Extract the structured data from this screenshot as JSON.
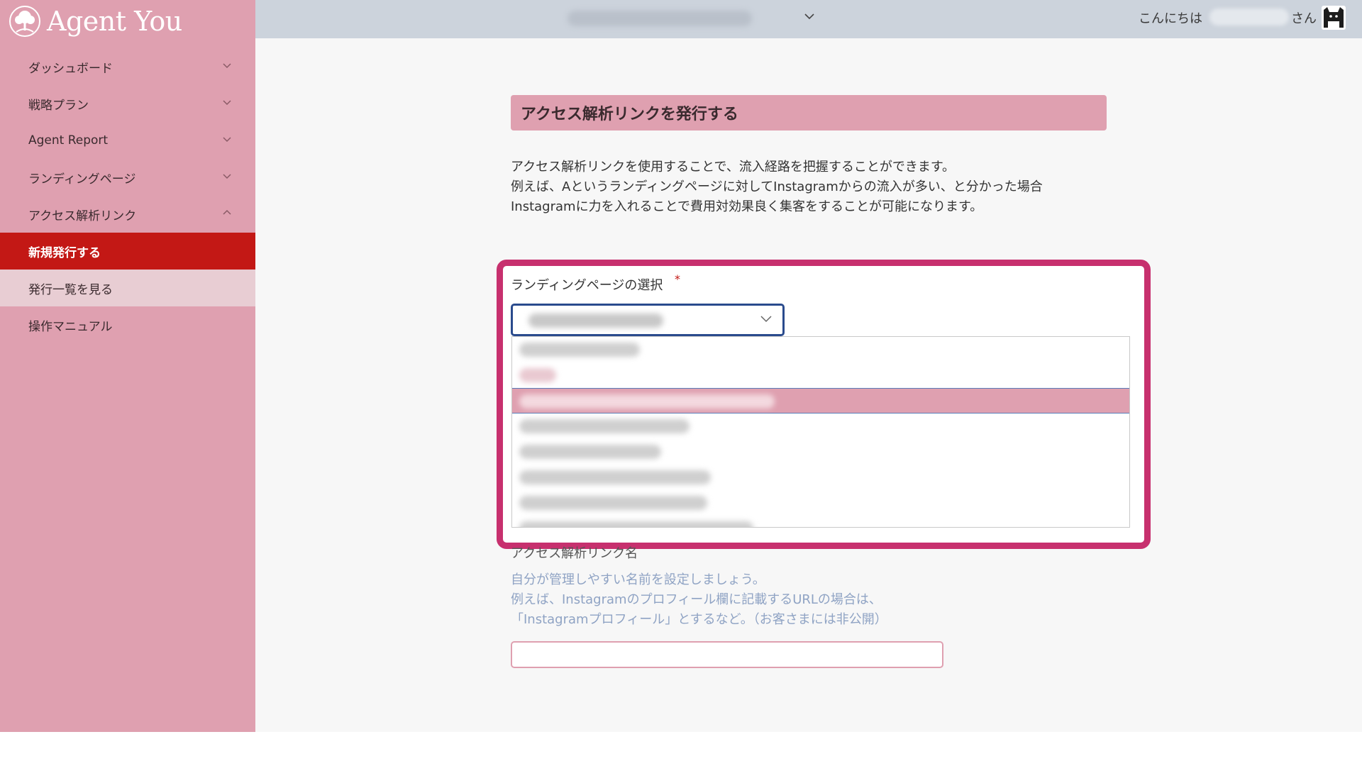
{
  "brand": {
    "name": "Agent You",
    "icon": "tree-logo-icon"
  },
  "colors": {
    "sidebar": "#dfa0b0",
    "active_nav": "#c31815",
    "topbar": "#ccd3dc",
    "highlight": "#c7306e",
    "helper_text": "#8fa3c4",
    "select_focus": "#2a4b8d"
  },
  "topbar": {
    "store_select_icon": "chevron-down-icon",
    "greeting": "こんにちは",
    "user_suffix": "さん",
    "avatar_icon": "cat-avatar-icon"
  },
  "sidebar": {
    "items": [
      {
        "label": "ダッシュボード",
        "icon": "chevron-down-icon"
      },
      {
        "label": "戦略プラン",
        "icon": "chevron-down-icon"
      },
      {
        "label": "Agent Report",
        "icon": "chevron-down-icon"
      },
      {
        "label": "ランディングページ",
        "icon": "chevron-down-icon"
      },
      {
        "label": "アクセス解析リンク",
        "icon": "chevron-up-icon"
      },
      {
        "label": "新規発行する",
        "state": "active"
      },
      {
        "label": "発行一覧を見る"
      },
      {
        "label": "操作マニュアル"
      }
    ]
  },
  "main": {
    "title": "アクセス解析リンクを発行する",
    "description": [
      "アクセス解析リンクを使用することで、流入経路を把握することができます。",
      "例えば、Aというランディングページに対してInstagramからの流入が多い、と分かった場合",
      "Instagramに力を入れることで費用対効果良く集客をすることが可能になります。"
    ],
    "landing_page_field": {
      "label": "ランディングページの選択",
      "required_mark": "*",
      "select_icon": "chevron-down-icon"
    },
    "link_name_field": {
      "label": "アクセス解析リンク名",
      "helper": [
        "自分が管理しやすい名前を設定しましょう。",
        "例えば、Instagramのプロフィール欄に記載するURLの場合は、",
        "「Instagramプロフィール」とするなど。（お客さまには非公開）"
      ],
      "value": ""
    }
  }
}
